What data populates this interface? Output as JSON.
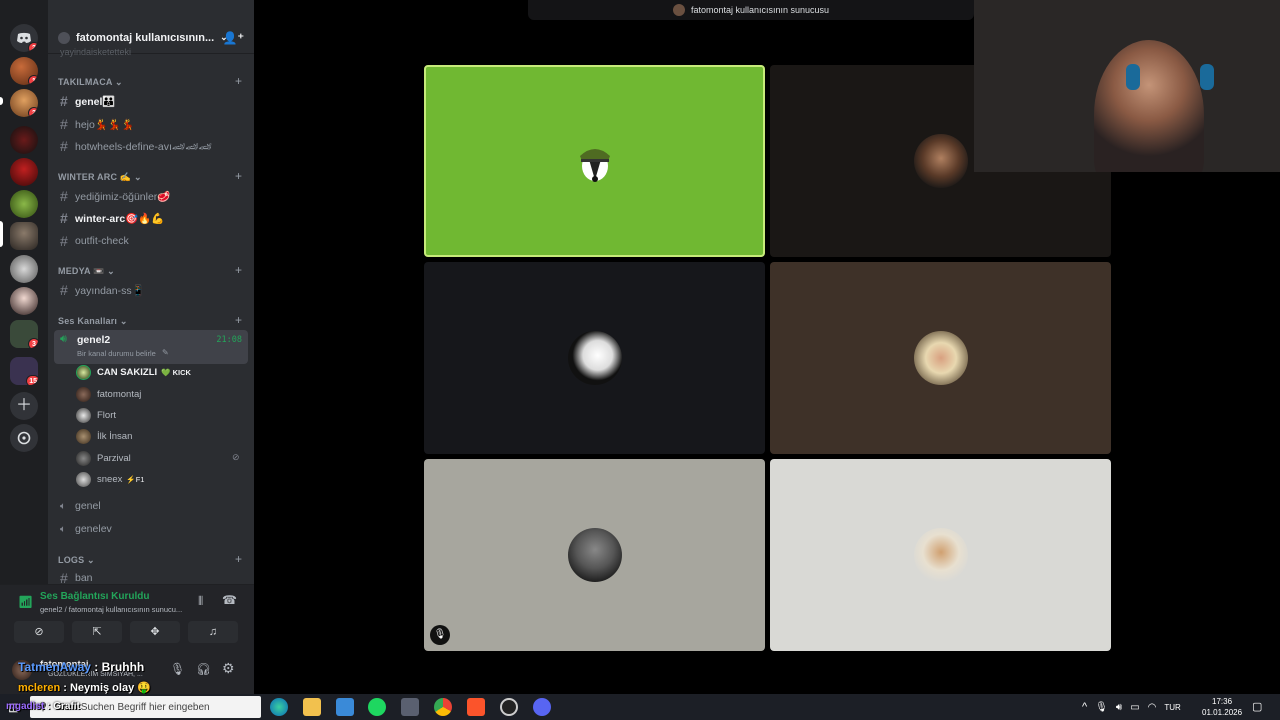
{
  "stream_title": "fatomontaj kullanıcısının sunucusu",
  "guild": {
    "name": "fatomontaj kullanıcısının..."
  },
  "categories": {
    "takilmaca": "TAKILMACA",
    "winter_arc": "WINTER ARC ✍",
    "medya": "MEDYA 📼",
    "ses": "Ses Kanalları",
    "logs": "LOGS"
  },
  "channels": {
    "cut_top": "yayindaisketetteki",
    "genel": "genel👨‍👨‍👦",
    "hejo": "hejo💃💃💃",
    "hotwheels": "hotwheels-define-avı🏎🏎🏎",
    "yedigimiz": "yediğimiz-öğünler🥩",
    "winterarc": "winter-arc🎯🔥💪",
    "outfit": "outfit-check",
    "yayindan": "yayından-ss📱",
    "ban": "ban"
  },
  "voice_channel": {
    "name": "genel2",
    "time": "21:08",
    "status": "Bir kanal durumu belirle"
  },
  "voice_users": [
    {
      "name": "CAN SAKIZLI",
      "tag": "💚 KICK"
    },
    {
      "name": "fatomontaj",
      "tag": ""
    },
    {
      "name": "Flort",
      "tag": ""
    },
    {
      "name": "İlk İnsan",
      "tag": ""
    },
    {
      "name": "Parzival",
      "tag": ""
    },
    {
      "name": "sneex",
      "tag": "⚡F1"
    }
  ],
  "other_voice": {
    "genel": "genel",
    "genelev": "genelev"
  },
  "connection": {
    "title": "Ses Bağlantısı Kuruldu",
    "subtitle": "genel2 / fatomontaj kullanıcısının sunucu..."
  },
  "user_panel": {
    "name": "fatomontaj",
    "status": "GÖZLÜKLERIM SIMSIYAH, ..."
  },
  "overlay_chat": [
    {
      "user": "TatmenAway",
      "sep": " : ",
      "text": "Bruhhh",
      "color": "#5b9bff"
    },
    {
      "user": "mcleren",
      "sep": " : ",
      "text": "Neymiş olay 🤑",
      "color": "#ffb000"
    },
    {
      "user": "mgadist",
      "sep": " : ",
      "text": "Grafit",
      "color": "#9b6bff"
    }
  ],
  "badges": [
    "2",
    "1",
    "2",
    "3",
    "15"
  ],
  "taskbar": {
    "search_placeholder": "Zum Suchen Begriff hier eingeben",
    "lang": "TUR",
    "time": "17:36",
    "date": "01.01.2026"
  },
  "colors": {
    "accent_green": "#23a55a",
    "discord_blurple": "#5865f2",
    "speaking_border": "#9bd23a"
  }
}
